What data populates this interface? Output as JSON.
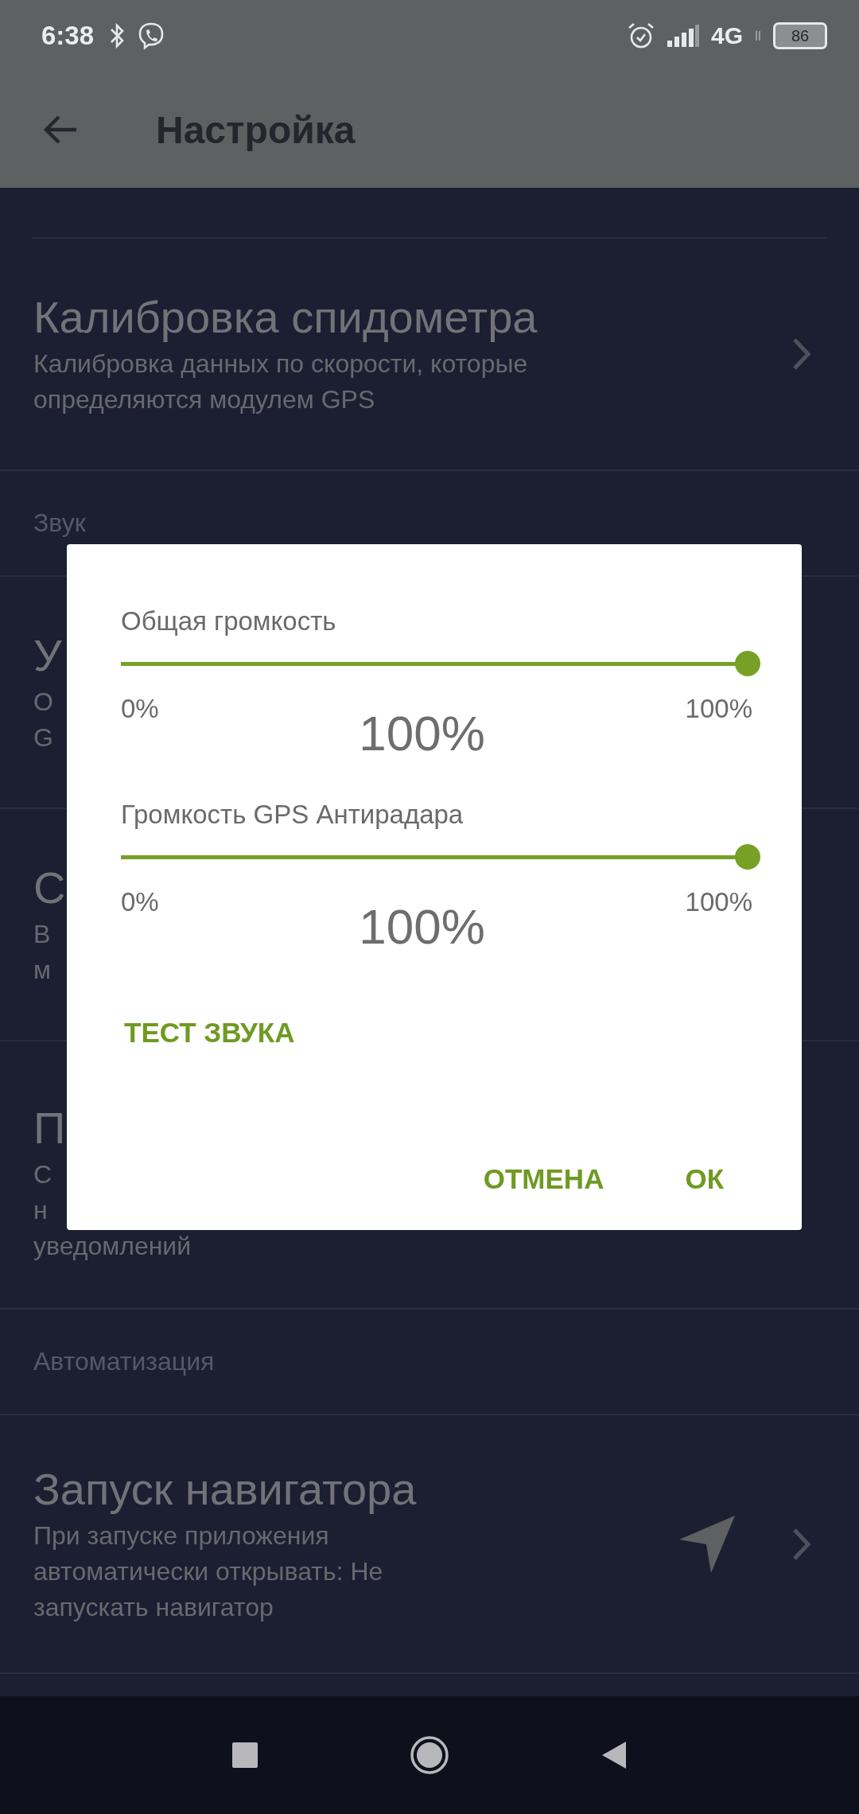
{
  "status_bar": {
    "time": "6:38",
    "network": "4G",
    "battery": "86"
  },
  "toolbar": {
    "title": "Настройка"
  },
  "settings": [
    {
      "kind": "item",
      "title": "Калибровка спидометра",
      "subtitle_lines": [
        "Калибровка данных по скорости, которые",
        "определяются модулем GPS"
      ],
      "chevron": true
    },
    {
      "kind": "section",
      "title": "Звук"
    },
    {
      "kind": "item",
      "title": "У",
      "subtitle_lines": [
        "О",
        "G"
      ],
      "chevron": false
    },
    {
      "kind": "item",
      "title": "С",
      "subtitle_lines": [
        "В",
        "м"
      ],
      "chevron": false
    },
    {
      "kind": "item",
      "title": "П",
      "subtitle_lines": [
        "С",
        "н",
        "уведомлений"
      ],
      "chevron": false
    },
    {
      "kind": "section",
      "title": "Автоматизация"
    },
    {
      "kind": "icon_item",
      "title": "Запуск навигатора",
      "subtitle_lines": [
        "При запуске приложения",
        "автоматически открывать: Не",
        "запускать навигатор"
      ],
      "chevron": true
    }
  ],
  "dialog": {
    "sliders": [
      {
        "label": "Общая громкость",
        "level": 1,
        "min": "0%",
        "value": "100%",
        "max": "100%"
      },
      {
        "label": "Громкость GPS Антирадара",
        "level": 1,
        "min": "0%",
        "value": "100%",
        "max": "100%"
      }
    ],
    "test_button": "ТЕСТ ЗВУКА",
    "buttons": [
      "ОТМЕНА",
      "ОК"
    ]
  }
}
